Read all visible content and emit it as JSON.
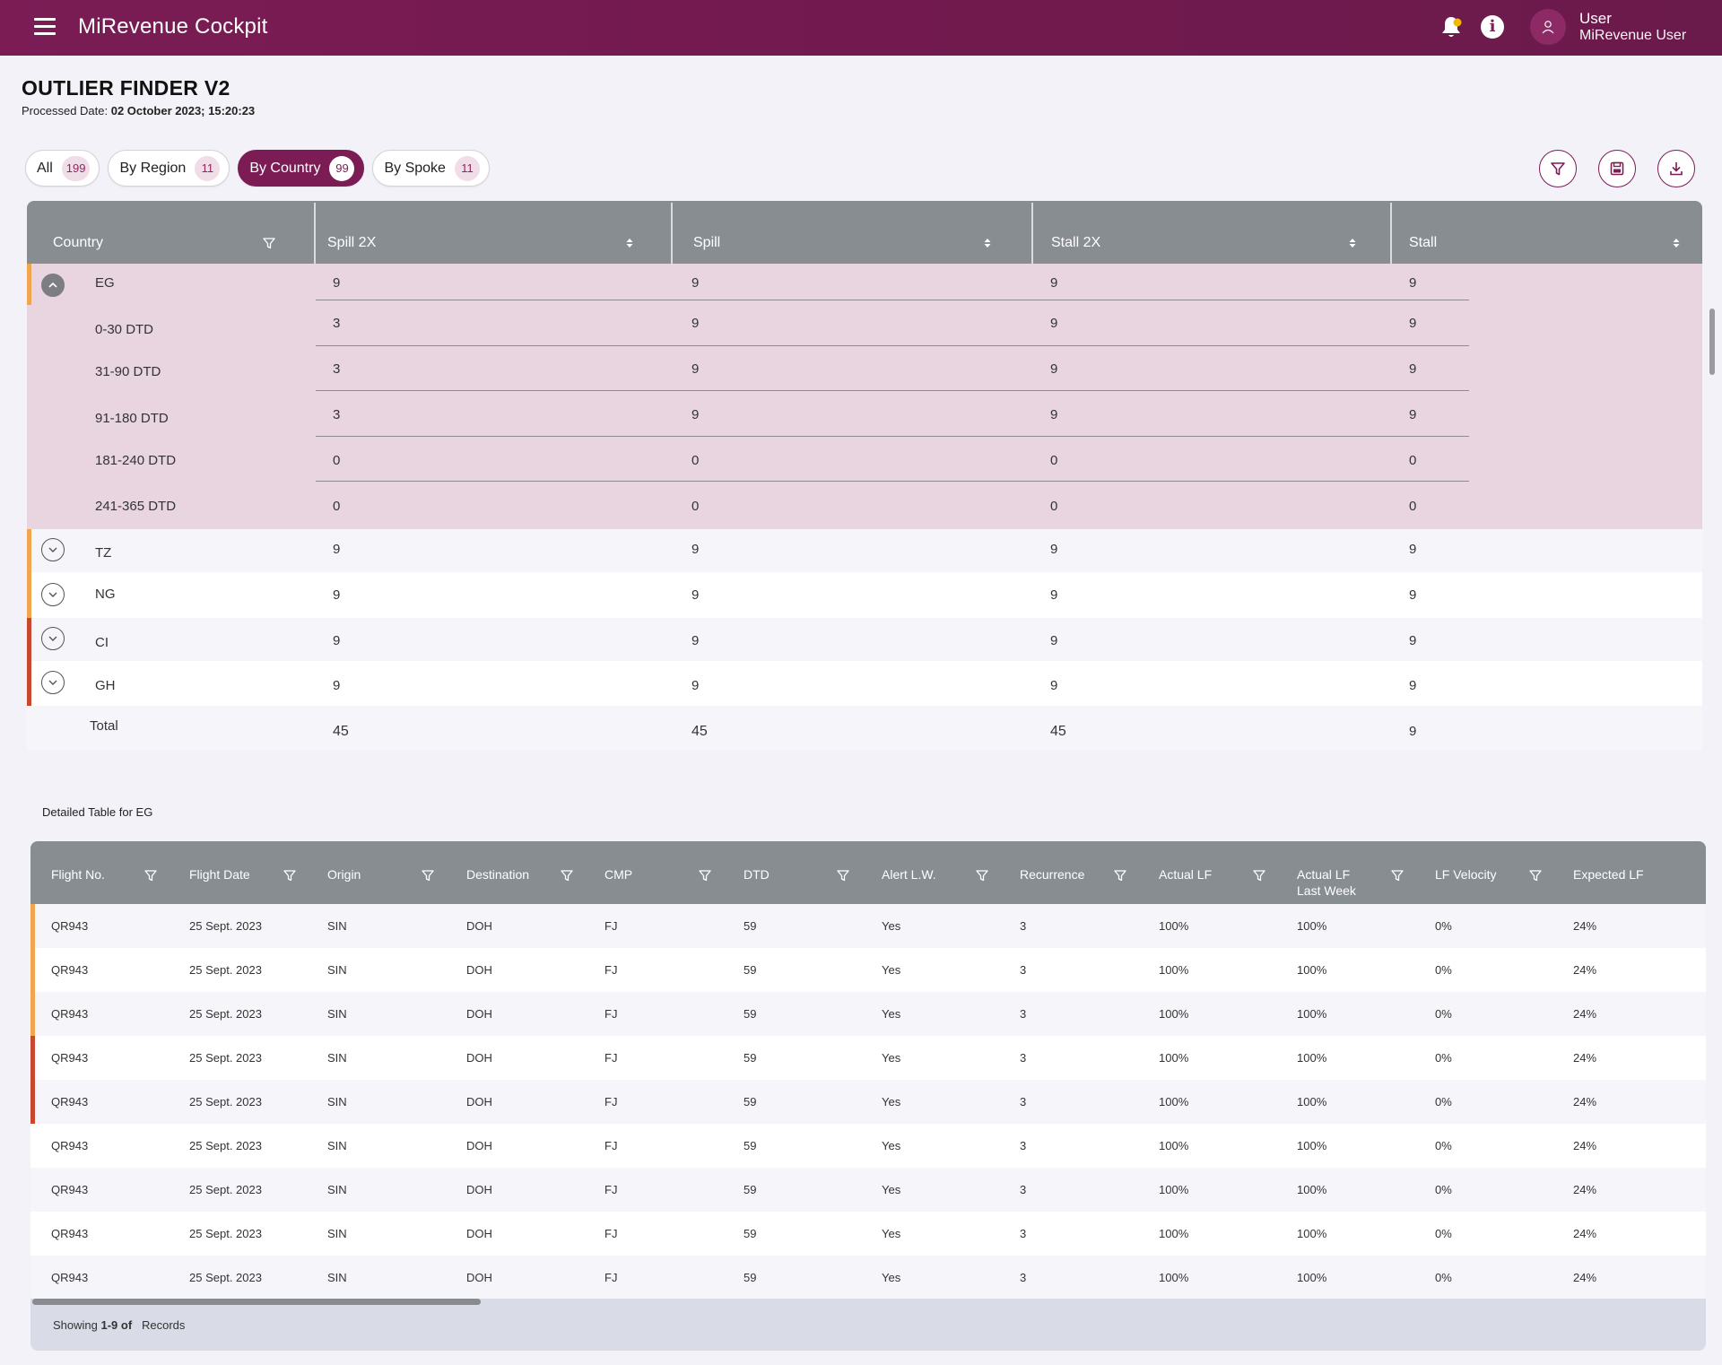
{
  "header": {
    "app_title": "MiRevenue Cockpit",
    "user_name": "User",
    "user_role": "MiRevenue User",
    "info_glyph": "i"
  },
  "page": {
    "title": "OUTLIER FINDER V2",
    "processed_label": "Processed Date:",
    "processed_value": "02 October 2023; 15:20:23"
  },
  "tabs": [
    {
      "label": "All",
      "count": "199"
    },
    {
      "label": "By Region",
      "count": "11"
    },
    {
      "label": "By Country",
      "count": "99",
      "active": true
    },
    {
      "label": "By Spoke",
      "count": "11"
    }
  ],
  "summary": {
    "columns": [
      "Country",
      "Spill 2X",
      "Spill",
      "Stall 2X",
      "Stall"
    ],
    "expanded": {
      "country": "EG",
      "values": [
        "9",
        "9",
        "9",
        "9"
      ],
      "subrows": [
        {
          "label": "0-30 DTD",
          "values": [
            "3",
            "9",
            "9",
            "9"
          ]
        },
        {
          "label": "31-90 DTD",
          "values": [
            "3",
            "9",
            "9",
            "9"
          ]
        },
        {
          "label": "91-180 DTD",
          "values": [
            "3",
            "9",
            "9",
            "9"
          ]
        },
        {
          "label": "181-240 DTD",
          "values": [
            "0",
            "0",
            "0",
            "0"
          ]
        },
        {
          "label": "241-365 DTD",
          "values": [
            "0",
            "0",
            "0",
            "0"
          ]
        }
      ]
    },
    "rows": [
      {
        "country": "TZ",
        "values": [
          "9",
          "9",
          "9",
          "9"
        ]
      },
      {
        "country": "NG",
        "values": [
          "9",
          "9",
          "9",
          "9"
        ]
      },
      {
        "country": "CI",
        "values": [
          "9",
          "9",
          "9",
          "9"
        ]
      },
      {
        "country": "GH",
        "values": [
          "9",
          "9",
          "9",
          "9"
        ]
      }
    ],
    "total": {
      "label": "Total",
      "values": [
        "45",
        "45",
        "45",
        "9"
      ]
    }
  },
  "detail": {
    "label": "Detailed Table for EG",
    "columns": [
      "Flight No.",
      "Flight Date",
      "Origin",
      "Destination",
      "CMP",
      "DTD",
      "Alert L.W.",
      "Recurrence",
      "Actual LF",
      "Actual LF Last Week",
      "LF Velocity",
      "Expected LF"
    ],
    "rows": [
      [
        "QR943",
        "25 Sept. 2023",
        "SIN",
        "DOH",
        "FJ",
        "59",
        "Yes",
        "3",
        "100%",
        "100%",
        "0%",
        "24%"
      ],
      [
        "QR943",
        "25 Sept. 2023",
        "SIN",
        "DOH",
        "FJ",
        "59",
        "Yes",
        "3",
        "100%",
        "100%",
        "0%",
        "24%"
      ],
      [
        "QR943",
        "25 Sept. 2023",
        "SIN",
        "DOH",
        "FJ",
        "59",
        "Yes",
        "3",
        "100%",
        "100%",
        "0%",
        "24%"
      ],
      [
        "QR943",
        "25 Sept. 2023",
        "SIN",
        "DOH",
        "FJ",
        "59",
        "Yes",
        "3",
        "100%",
        "100%",
        "0%",
        "24%"
      ],
      [
        "QR943",
        "25 Sept. 2023",
        "SIN",
        "DOH",
        "FJ",
        "59",
        "Yes",
        "3",
        "100%",
        "100%",
        "0%",
        "24%"
      ],
      [
        "QR943",
        "25 Sept. 2023",
        "SIN",
        "DOH",
        "FJ",
        "59",
        "Yes",
        "3",
        "100%",
        "100%",
        "0%",
        "24%"
      ],
      [
        "QR943",
        "25 Sept. 2023",
        "SIN",
        "DOH",
        "FJ",
        "59",
        "Yes",
        "3",
        "100%",
        "100%",
        "0%",
        "24%"
      ],
      [
        "QR943",
        "25 Sept. 2023",
        "SIN",
        "DOH",
        "FJ",
        "59",
        "Yes",
        "3",
        "100%",
        "100%",
        "0%",
        "24%"
      ],
      [
        "QR943",
        "25 Sept. 2023",
        "SIN",
        "DOH",
        "FJ",
        "59",
        "Yes",
        "3",
        "100%",
        "100%",
        "0%",
        "24%"
      ]
    ],
    "row_marks": [
      "orange",
      "orange",
      "orange",
      "red",
      "red",
      "none",
      "none",
      "none",
      "none"
    ],
    "footer_prefix": "Showing ",
    "footer_range": "1-9 of",
    "footer_suffix": "Records"
  },
  "colors": {
    "brand": "#7b1c55",
    "header_gray": "#888d92",
    "expanded_bg": "#e8d5e0",
    "mark_orange": "#f0a54e",
    "mark_red": "#c8472f",
    "bell_dot": "#f5b800"
  },
  "icons": {
    "menu": "hamburger-icon",
    "bell": "bell-icon",
    "info": "info-icon",
    "user": "user-icon",
    "filter": "filter-icon",
    "save": "save-icon",
    "download": "download-icon",
    "sort": "sort-icon",
    "expand": "chevron-down-icon",
    "collapse": "chevron-up-icon"
  }
}
